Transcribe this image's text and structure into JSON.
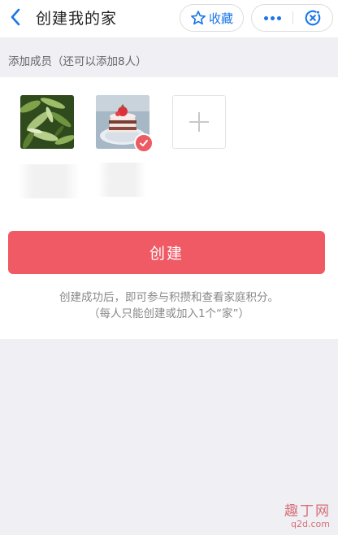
{
  "header": {
    "title": "创建我的家",
    "favorite_label": "收藏"
  },
  "section": {
    "label": "添加成员（还可以添加8人）"
  },
  "members": [
    {
      "avatar": "green-vegetables-photo",
      "name": "",
      "selected": false
    },
    {
      "avatar": "strawberry-cake-photo",
      "name": "",
      "selected": true
    }
  ],
  "add_member_icon": "plus-icon",
  "create_button": {
    "label": "创建"
  },
  "tips": {
    "line1": "创建成功后，即可参与积攒和查看家庭积分。",
    "line2": "（每人只能创建或加入1个“家”）"
  },
  "colors": {
    "accent": "#1a75e8",
    "primary_button": "#ef5a64",
    "badge": "#ec5a64",
    "page_bg": "#efeff4"
  },
  "watermark": {
    "text": "趣丁网",
    "url": "q2d.com"
  }
}
